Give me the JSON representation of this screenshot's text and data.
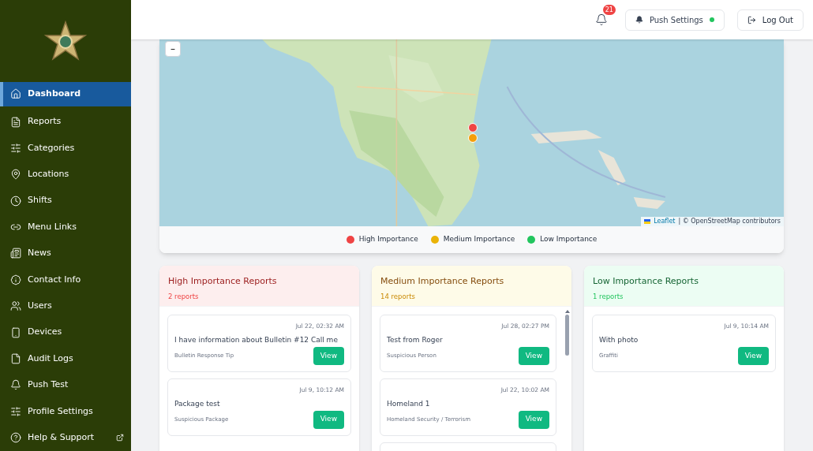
{
  "sidebar": {
    "items": [
      {
        "label": "Dashboard",
        "selected": true
      },
      {
        "label": "Reports",
        "selected": false
      },
      {
        "label": "Categories",
        "selected": false
      },
      {
        "label": "Locations",
        "selected": false
      },
      {
        "label": "Shifts",
        "selected": false
      },
      {
        "label": "Menu Links",
        "selected": false
      },
      {
        "label": "News",
        "selected": false
      },
      {
        "label": "Contact Info",
        "selected": false
      },
      {
        "label": "Users",
        "selected": false
      },
      {
        "label": "Devices",
        "selected": false
      },
      {
        "label": "Audit Logs",
        "selected": false
      },
      {
        "label": "Push Test",
        "selected": false
      },
      {
        "label": "Profile Settings",
        "selected": false
      },
      {
        "label": "Help & Support",
        "selected": false,
        "external": true
      }
    ]
  },
  "header": {
    "notifications": "21",
    "push_settings": {
      "label": "Push Settings",
      "on": true
    },
    "logout": "Log Out"
  },
  "map": {
    "zoom_out": "–",
    "markers": [
      {
        "color": "#ef4444"
      },
      {
        "color": "#f59e0b"
      }
    ],
    "attribution": {
      "link": "Leaflet",
      "text": "| © OpenStreetMap contributors"
    },
    "legend": [
      {
        "label": "High Importance",
        "color": "#ef4444"
      },
      {
        "label": "Medium Importance",
        "color": "#eab308"
      },
      {
        "label": "Low Importance",
        "color": "#22c55e"
      }
    ]
  },
  "columns": [
    {
      "kind": "high",
      "title": "High Importance Reports",
      "count": "2 reports",
      "scrollable": false,
      "reports": [
        {
          "time": "Jul 22, 02:32 AM",
          "title": "I have information about Bulletin #12 Call me",
          "category": "Bulletin Response Tip",
          "action": "View"
        },
        {
          "time": "Jul 9, 10:12 AM",
          "title": "Package test",
          "category": "Suspicious Package",
          "action": "View"
        }
      ]
    },
    {
      "kind": "medium",
      "title": "Medium Importance Reports",
      "count": "14 reports",
      "scrollable": true,
      "reports": [
        {
          "time": "Jul 28, 02:27 PM",
          "title": "Test from Roger",
          "category": "Suspicious Person",
          "action": "View"
        },
        {
          "time": "Jul 22, 10:02 AM",
          "title": "Homeland 1",
          "category": "Homeland Security / Terrorism",
          "action": "View"
        }
      ]
    },
    {
      "kind": "low",
      "title": "Low Importance Reports",
      "count": "1 reports",
      "scrollable": false,
      "reports": [
        {
          "time": "Jul 9, 10:14 AM",
          "title": "With photo",
          "category": "Graffiti",
          "action": "View"
        }
      ]
    }
  ]
}
